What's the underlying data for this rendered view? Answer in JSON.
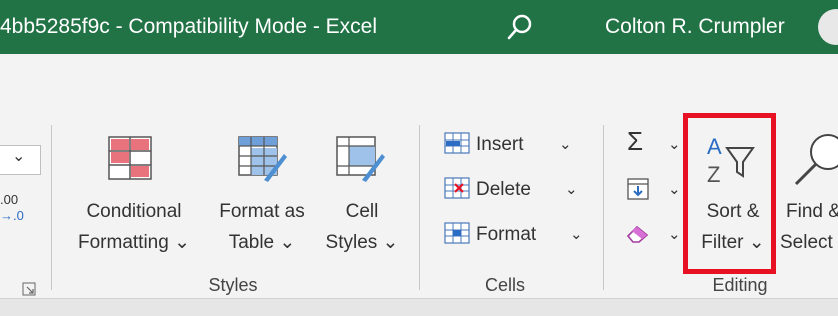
{
  "titlebar": {
    "title": "4bb5285f9c  -  Compatibility Mode  -  Excel",
    "user": "Colton R. Crumpler"
  },
  "left_fragment": {
    "dropdown_arrow": "⌄",
    "number_format": ".00\n→.0"
  },
  "styles_group": {
    "label": "Styles",
    "conditional_formatting": {
      "line1": "Conditional",
      "line2": "Formatting ⌄"
    },
    "format_as_table": {
      "line1": "Format as",
      "line2": "Table ⌄"
    },
    "cell_styles": {
      "line1": "Cell",
      "line2": "Styles ⌄"
    }
  },
  "cells_group": {
    "label": "Cells",
    "insert": "Insert",
    "delete": "Delete",
    "format": "Format"
  },
  "editing_group": {
    "label": "Editing",
    "sort_filter": {
      "line1": "Sort &",
      "line2": "Filter ⌄"
    },
    "find_select": {
      "line1": "Find &",
      "line2": "Select"
    }
  },
  "colors": {
    "excel_green": "#217346",
    "highlight_red": "#e81123"
  }
}
